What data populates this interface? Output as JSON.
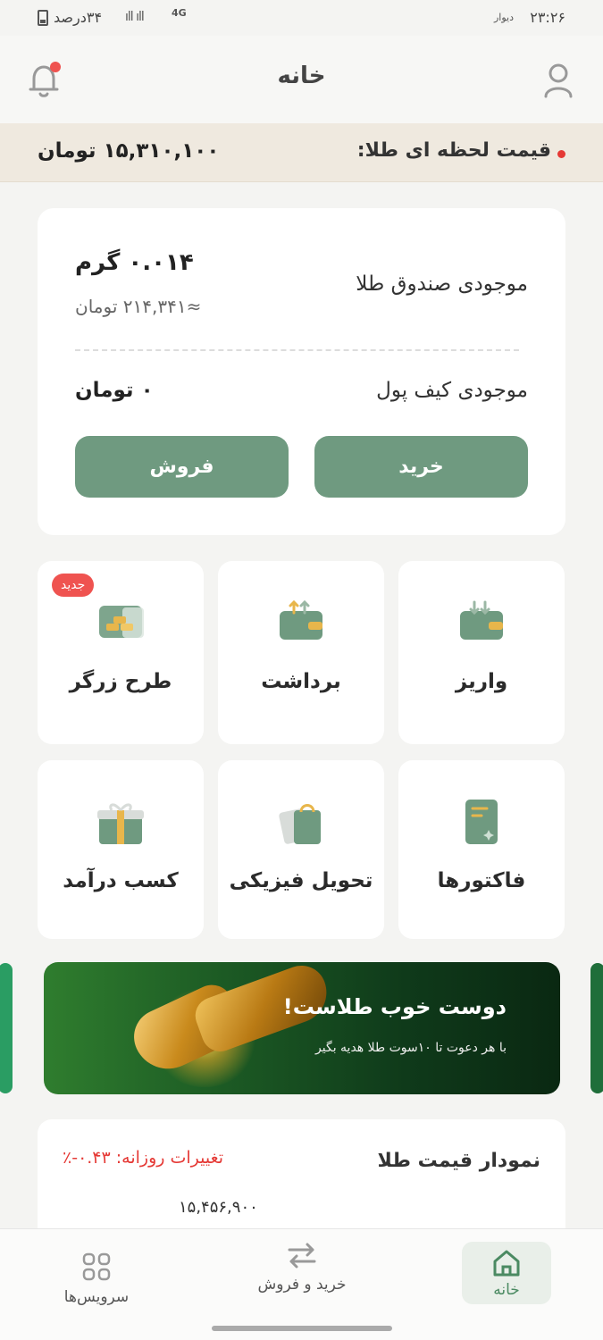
{
  "status_bar": {
    "time": "۲۳:۲۶",
    "carrier": "دیوار",
    "battery": "۳۴درصد",
    "network": "4G"
  },
  "header": {
    "title": "خانه"
  },
  "price_bar": {
    "label": "قیمت لحظه ای طلا:",
    "value": "۱۵,۳۱۰,۱۰۰ تومان"
  },
  "balance": {
    "gold_label": "موجودی صندوق طلا",
    "gold_value": "۰.۰۱۴ گرم",
    "gold_toman": "≈۲۱۴,۳۴۱ تومان",
    "wallet_label": "موجودی کیف پول",
    "wallet_value": "۰ تومان",
    "buy_label": "خرید",
    "sell_label": "فروش"
  },
  "services": [
    {
      "label": "واریز",
      "icon": "deposit-wallet-icon"
    },
    {
      "label": "برداشت",
      "icon": "withdraw-wallet-icon"
    },
    {
      "label": "طرح زرگر",
      "icon": "gold-bars-icon",
      "badge": "جدید"
    },
    {
      "label": "فاکتورها",
      "icon": "invoice-icon"
    },
    {
      "label": "تحویل فیزیکی",
      "icon": "shopping-bag-icon"
    },
    {
      "label": "کسب درآمد",
      "icon": "gift-icon"
    }
  ],
  "banner": {
    "title": "دوست خوب طلاست!",
    "subtitle": "با هر دعوت تا ۱۰سوت طلا هدیه بگیر"
  },
  "chart_card": {
    "title": "نمودار قیمت طلا",
    "change": "تغییرات روزانه: ۰.۴۳-٪",
    "price": "۱۵,۴۵۶,۹۰۰"
  },
  "bottom_nav": {
    "home": "خانه",
    "trade": "خرید و فروش",
    "services": "سرویس‌ها"
  },
  "colors": {
    "accent": "#6f9a80",
    "price_bar_bg": "#efe9df",
    "negative": "#e53935"
  }
}
